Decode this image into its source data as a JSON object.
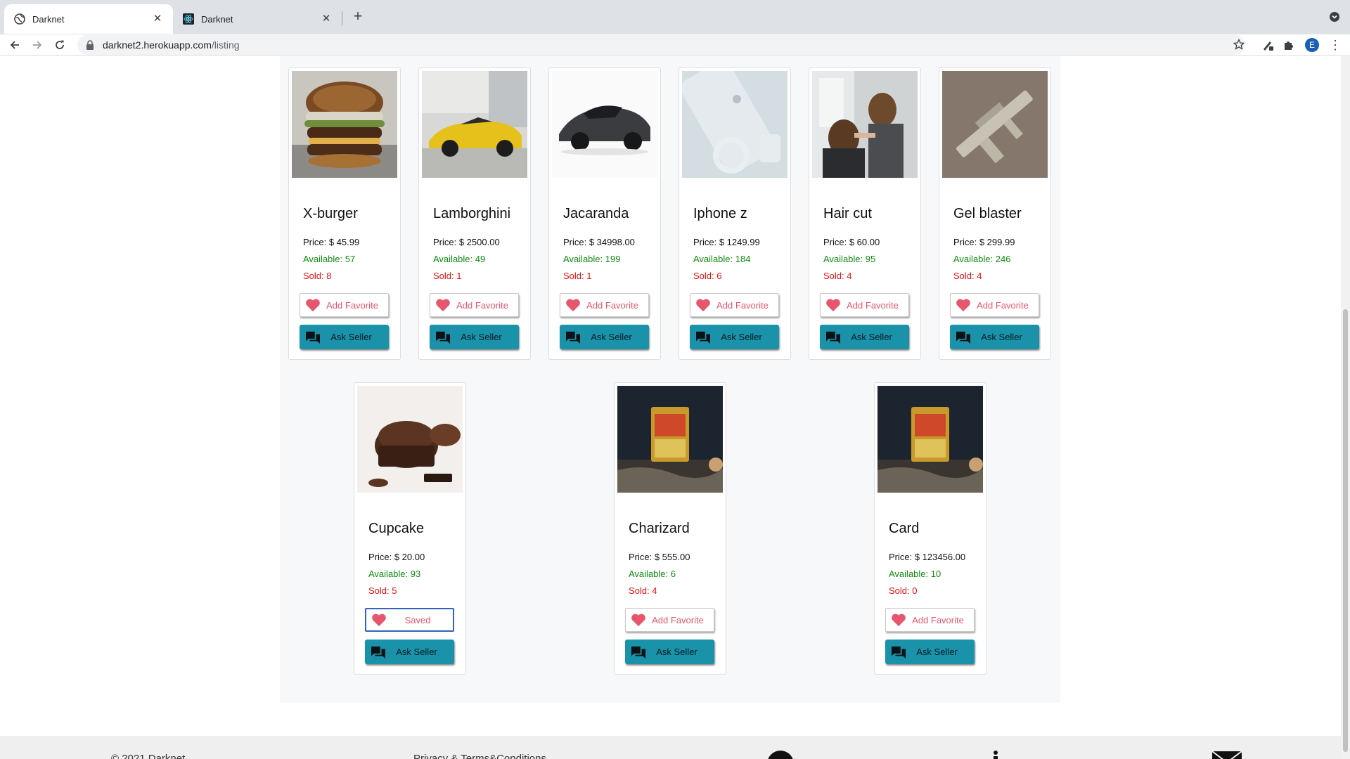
{
  "browser": {
    "tabs": [
      {
        "title": "Darknet",
        "active": true
      },
      {
        "title": "Darknet",
        "active": false
      }
    ],
    "url_host": "darknet2.herokuapp.com",
    "url_path": "/listing",
    "profile_initial": "E"
  },
  "listing": {
    "products": [
      {
        "name": "X-burger",
        "price": "Price: $ 45.99",
        "available": "Available: 57",
        "sold": "Sold: 8",
        "favorite": "Add Favorite",
        "ask": "Ask Seller"
      },
      {
        "name": "Lamborghini",
        "price": "Price: $ 2500.00",
        "available": "Available: 49",
        "sold": "Sold: 1",
        "favorite": "Add Favorite",
        "ask": "Ask Seller"
      },
      {
        "name": "Jacaranda",
        "price": "Price: $ 34998.00",
        "available": "Available: 199",
        "sold": "Sold: 1",
        "favorite": "Add Favorite",
        "ask": "Ask Seller"
      },
      {
        "name": "Iphone z",
        "price": "Price: $ 1249.99",
        "available": "Available: 184",
        "sold": "Sold: 6",
        "favorite": "Add Favorite",
        "ask": "Ask Seller"
      },
      {
        "name": "Hair cut",
        "price": "Price: $ 60.00",
        "available": "Available: 95",
        "sold": "Sold: 4",
        "favorite": "Add Favorite",
        "ask": "Ask Seller"
      },
      {
        "name": "Gel blaster",
        "price": "Price: $ 299.99",
        "available": "Available: 246",
        "sold": "Sold: 4",
        "favorite": "Add Favorite",
        "ask": "Ask Seller"
      },
      {
        "name": "Cupcake",
        "price": "Price: $ 20.00",
        "available": "Available: 93",
        "sold": "Sold: 5",
        "favorite": "Saved",
        "ask": "Ask Seller"
      },
      {
        "name": "Charizard",
        "price": "Price: $ 555.00",
        "available": "Available: 6",
        "sold": "Sold: 4",
        "favorite": "Add Favorite",
        "ask": "Ask Seller"
      },
      {
        "name": "Card",
        "price": "Price: $ 123456.00",
        "available": "Available: 10",
        "sold": "Sold: 0",
        "favorite": "Add Favorite",
        "ask": "Ask Seller"
      }
    ]
  },
  "footer": {
    "copyright": "© 2021 Darknet",
    "privacy": "Privacy & Terms&Conditions"
  },
  "colors": {
    "ask_button": "#1992aa",
    "favorite_text": "#e6576e",
    "available": "#118a11",
    "sold": "#e8100f"
  }
}
